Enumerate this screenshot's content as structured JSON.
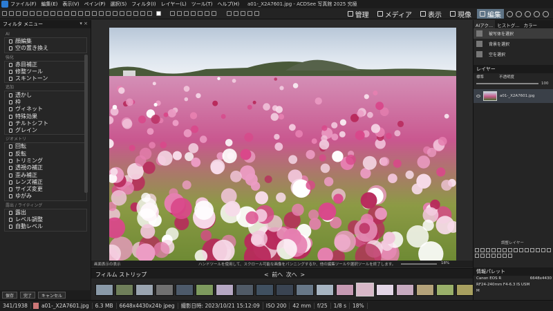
{
  "menu": [
    "ファイル(F)",
    "編集(E)",
    "表示(V)",
    "ペイン(P)",
    "選択(S)",
    "フィルタ(I)",
    "レイヤー(L)",
    "ツール(T)",
    "ヘルプ(H)"
  ],
  "window_title": "a01-_X2A7601.jpg - ACDSee 写真館 2025 究極",
  "modes": [
    "管理",
    "メディア",
    "表示",
    "現像",
    "編集"
  ],
  "active_mode": "編集",
  "left_panel": {
    "title": "フィルタ メニュー",
    "groups": [
      {
        "name": "AI",
        "items": [
          "顔編集",
          "空の置き換え"
        ]
      },
      {
        "name": "強化",
        "items": [
          "赤目補正",
          "修整ツール",
          "スキントーン"
        ]
      },
      {
        "name": "追加",
        "items": [
          "透かし",
          "枠",
          "ヴィネット",
          "特殊効果",
          "チルトシフト",
          "グレイン"
        ]
      },
      {
        "name": "ジオメトリ",
        "items": [
          "回転",
          "反転",
          "トリミング",
          "透視の補正",
          "歪み補正",
          "レンズ補正",
          "サイズ変更",
          "ゆがみ"
        ]
      },
      {
        "name": "露出 / ライティング",
        "items": [
          "露出",
          "レベル調整",
          "自動レベル"
        ]
      }
    ],
    "buttons": [
      "保存",
      "完了",
      "キャンセル"
    ]
  },
  "status_line": {
    "zoom_label": "画面表示の表示",
    "hint": "ハンドツールを使用して、スクロール可能な画像をパンニングするか、他の編集ツールや選択ツールを終了します。",
    "zoom_pct": "18%"
  },
  "filmstrip": {
    "title": "フィルム ストリップ",
    "nav": "< 前へ 次へ >",
    "thumb_colors": [
      "#8a9aa8",
      "#6f7f5a",
      "#9aa4b0",
      "#707070",
      "#4d5a6a",
      "#7e9a5e",
      "#b6a8c4",
      "#505a66",
      "#405060",
      "#3a4452",
      "#687888",
      "#a7b5c2",
      "#c69ab3",
      "#d8b8c8",
      "#e3d6e6",
      "#c7aac0",
      "#b4a27a",
      "#9ab06a",
      "#a8a060",
      "#7c8c50",
      "#5c6a48"
    ],
    "selected_index": 13
  },
  "right_panel": {
    "tabs": [
      "AIアク...",
      "ヒストグ...",
      "カラー"
    ],
    "ai_tools": [
      "被写体を選択",
      "背景を選択",
      "空を選択"
    ],
    "layers_title": "レイヤー",
    "blend_mode": "標準",
    "opacity_label": "不透明度",
    "opacity_value": "100",
    "layer_name": "a01-_X2A7601.jpg",
    "adjust_layer_label": "調整レイヤー",
    "info_title": "情報パレット",
    "camera": "Canon EOS R",
    "camera_right": "6648x4430",
    "lens": "RF24-240mm F4-6.3 IS USM",
    "mode_label": "M"
  },
  "bottom_bar": {
    "counter": "341/1938",
    "filename": "a01-_X2A7601.jpg",
    "filesize": "6.3 MB",
    "dimensions": "6648x4430x24b jpeg",
    "date": "撮影日時: 2023/10/21 15:12:09",
    "iso": "ISO 200",
    "focal": "42 mm",
    "aperture": "f/25",
    "shutter": "1/8 s",
    "zoom": "18%"
  }
}
